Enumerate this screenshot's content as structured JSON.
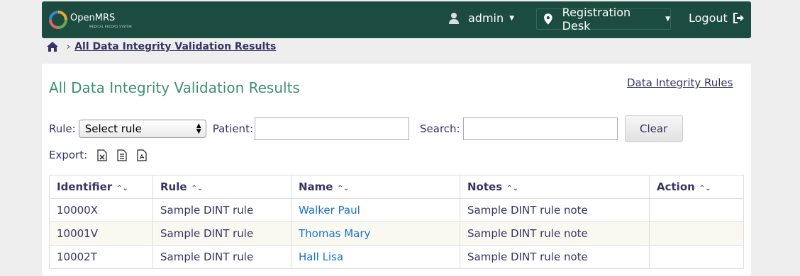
{
  "header": {
    "logo_text": "OpenMRS",
    "logo_subtext": "MEDICAL RECORD SYSTEM",
    "user": "admin",
    "location": "Registration Desk",
    "logout": "Logout"
  },
  "breadcrumb": {
    "current": "All Data Integrity Validation Results"
  },
  "page": {
    "title": "All Data Integrity Validation Results",
    "rules_link": "Data Integrity Rules"
  },
  "filters": {
    "rule_label": "Rule:",
    "rule_selected": "Select rule",
    "patient_label": "Patient:",
    "patient_value": "",
    "search_label": "Search:",
    "search_value": "",
    "clear_label": "Clear"
  },
  "export": {
    "label": "Export:",
    "icons": [
      "excel-icon",
      "text-file-icon",
      "pdf-icon"
    ]
  },
  "table": {
    "columns": [
      "Identifier",
      "Rule",
      "Name",
      "Notes",
      "Action"
    ],
    "rows": [
      {
        "identifier": "10000X",
        "rule": "Sample DINT rule",
        "name": "Walker Paul",
        "notes": "Sample DINT rule note",
        "action": ""
      },
      {
        "identifier": "10001V",
        "rule": "Sample DINT rule",
        "name": "Thomas Mary",
        "notes": "Sample DINT rule note",
        "action": ""
      },
      {
        "identifier": "10002T",
        "rule": "Sample DINT rule",
        "name": "Hall Lisa",
        "notes": "Sample DINT rule note",
        "action": ""
      }
    ]
  },
  "colors": {
    "header_bg": "#1c4c3f",
    "title_green": "#3e8f74",
    "link_blue": "#1a73c7",
    "text": "#363463",
    "alt_row": "#f9f8f1"
  }
}
